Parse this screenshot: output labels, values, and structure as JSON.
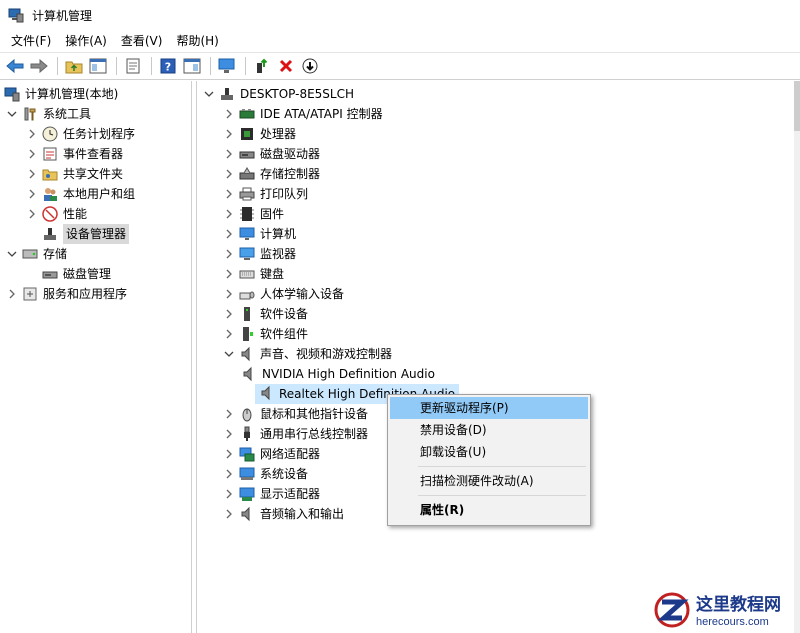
{
  "window": {
    "title": "计算机管理"
  },
  "menu": [
    "文件(F)",
    "操作(A)",
    "查看(V)",
    "帮助(H)"
  ],
  "left_tree": {
    "root": "计算机管理(本地)",
    "system_tools": "系统工具",
    "system_children": [
      "任务计划程序",
      "事件查看器",
      "共享文件夹",
      "本地用户和组",
      "性能",
      "设备管理器"
    ],
    "storage": "存储",
    "storage_children": [
      "磁盘管理"
    ],
    "services": "服务和应用程序"
  },
  "device_tree": {
    "root": "DESKTOP-8E5SLCH",
    "categories": [
      "IDE ATA/ATAPI 控制器",
      "处理器",
      "磁盘驱动器",
      "存储控制器",
      "打印队列",
      "固件",
      "计算机",
      "监视器",
      "键盘",
      "人体学输入设备",
      "软件设备",
      "软件组件",
      "声音、视频和游戏控制器",
      "鼠标和其他指针设备",
      "通用串行总线控制器",
      "网络适配器",
      "系统设备",
      "显示适配器",
      "音频输入和输出"
    ],
    "audio_children": [
      "NVIDIA High Definition Audio",
      "Realtek High Definition Audio"
    ]
  },
  "context_menu": {
    "items": [
      "更新驱动程序(P)",
      "禁用设备(D)",
      "卸载设备(U)",
      "扫描检测硬件改动(A)",
      "属性(R)"
    ]
  },
  "watermark": {
    "cn": "这里教程网",
    "en": "herecours.com"
  },
  "colors": {
    "selection": "#cce8ff",
    "menu_hover": "#91c9f7",
    "accent": "#1d3a8a"
  }
}
